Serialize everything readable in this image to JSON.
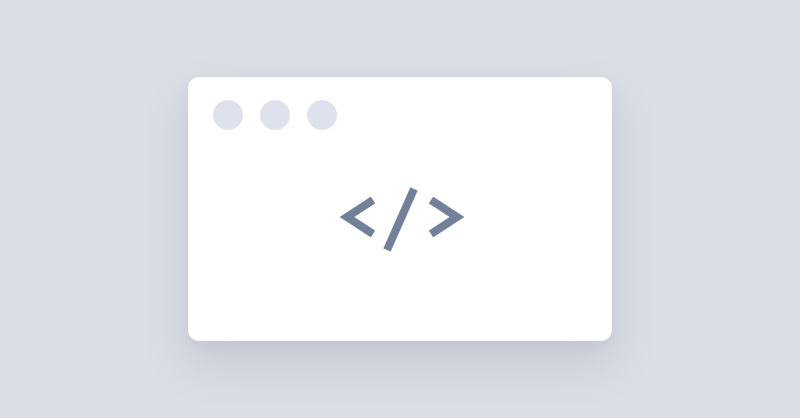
{
  "window": {
    "controls": [
      {
        "name": "window-dot-1"
      },
      {
        "name": "window-dot-2"
      },
      {
        "name": "window-dot-3"
      }
    ],
    "center_icon": "code-brackets-icon"
  },
  "colors": {
    "background": "#dcdee6",
    "window": "#ffffff",
    "dot": "#dfe2ec",
    "icon": "#728099"
  }
}
